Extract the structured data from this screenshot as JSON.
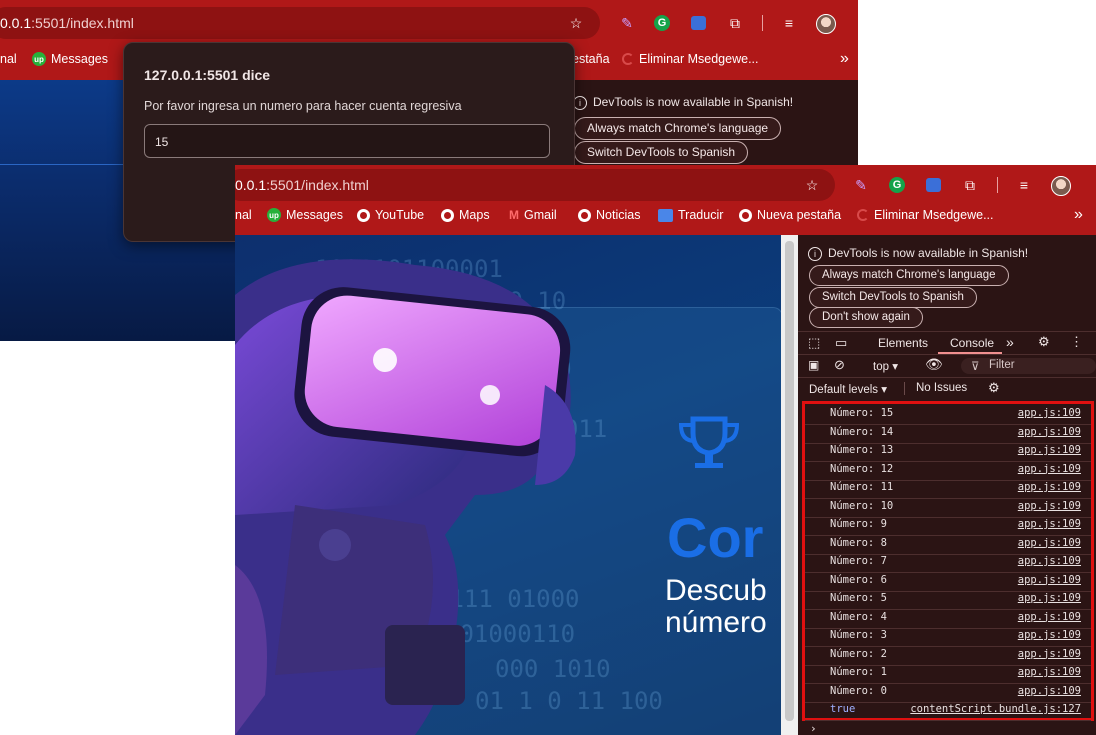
{
  "back_window": {
    "url_host": "0.0.1",
    "url_rest": ":5501/index.html",
    "bookmarks": [
      "nal",
      "Messages",
      "estaña",
      "Eliminar Msedgewe..."
    ],
    "more": "»",
    "devtools_notice": "DevTools is now available in Spanish!",
    "btn_match": "Always match Chrome's language",
    "btn_switch": "Switch DevTools to Spanish"
  },
  "dialog": {
    "title": "127.0.0.1:5501 dice",
    "message": "Por favor ingresa un numero para hacer cuenta regresiva",
    "input_value": "15"
  },
  "front_window": {
    "url_host": "0.0.1",
    "url_rest": ":5501/index.html",
    "bookmarks": [
      "nal",
      "Messages",
      "YouTube",
      "Maps",
      "Gmail",
      "Noticias",
      "Traducir",
      "Nueva pestaña",
      "Eliminar Msedgewe..."
    ],
    "more": "»",
    "page": {
      "title": "Cor",
      "subtitle_1": "Descub",
      "subtitle_2": "número"
    }
  },
  "devtools": {
    "notice": "DevTools is now available in Spanish!",
    "btn_match": "Always match Chrome's language",
    "btn_switch": "Switch DevTools to Spanish",
    "btn_dont": "Don't show again",
    "tabs": {
      "elements": "Elements",
      "console": "Console",
      "more": "»"
    },
    "context": "top",
    "filter": "Filter",
    "levels": "Default levels",
    "issues": "No Issues",
    "logs": [
      {
        "text": "Número: 15",
        "src": "app.js:109"
      },
      {
        "text": "Número: 14",
        "src": "app.js:109"
      },
      {
        "text": "Número: 13",
        "src": "app.js:109"
      },
      {
        "text": "Número: 12",
        "src": "app.js:109"
      },
      {
        "text": "Número: 11",
        "src": "app.js:109"
      },
      {
        "text": "Número: 10",
        "src": "app.js:109"
      },
      {
        "text": "Número: 9",
        "src": "app.js:109"
      },
      {
        "text": "Número: 8",
        "src": "app.js:109"
      },
      {
        "text": "Número: 7",
        "src": "app.js:109"
      },
      {
        "text": "Número: 6",
        "src": "app.js:109"
      },
      {
        "text": "Número: 5",
        "src": "app.js:109"
      },
      {
        "text": "Número: 4",
        "src": "app.js:109"
      },
      {
        "text": "Número: 3",
        "src": "app.js:109"
      },
      {
        "text": "Número: 2",
        "src": "app.js:109"
      },
      {
        "text": "Número: 1",
        "src": "app.js:109"
      },
      {
        "text": "Número: 0",
        "src": "app.js:109"
      }
    ],
    "last_log": {
      "text": "true",
      "src": "contentScript.bundle.js:127"
    },
    "prompt": "›"
  },
  "colors": {
    "chrome_red": "#b01818",
    "highlight": "#e01010",
    "hero_blue": "#1a6ee6"
  }
}
